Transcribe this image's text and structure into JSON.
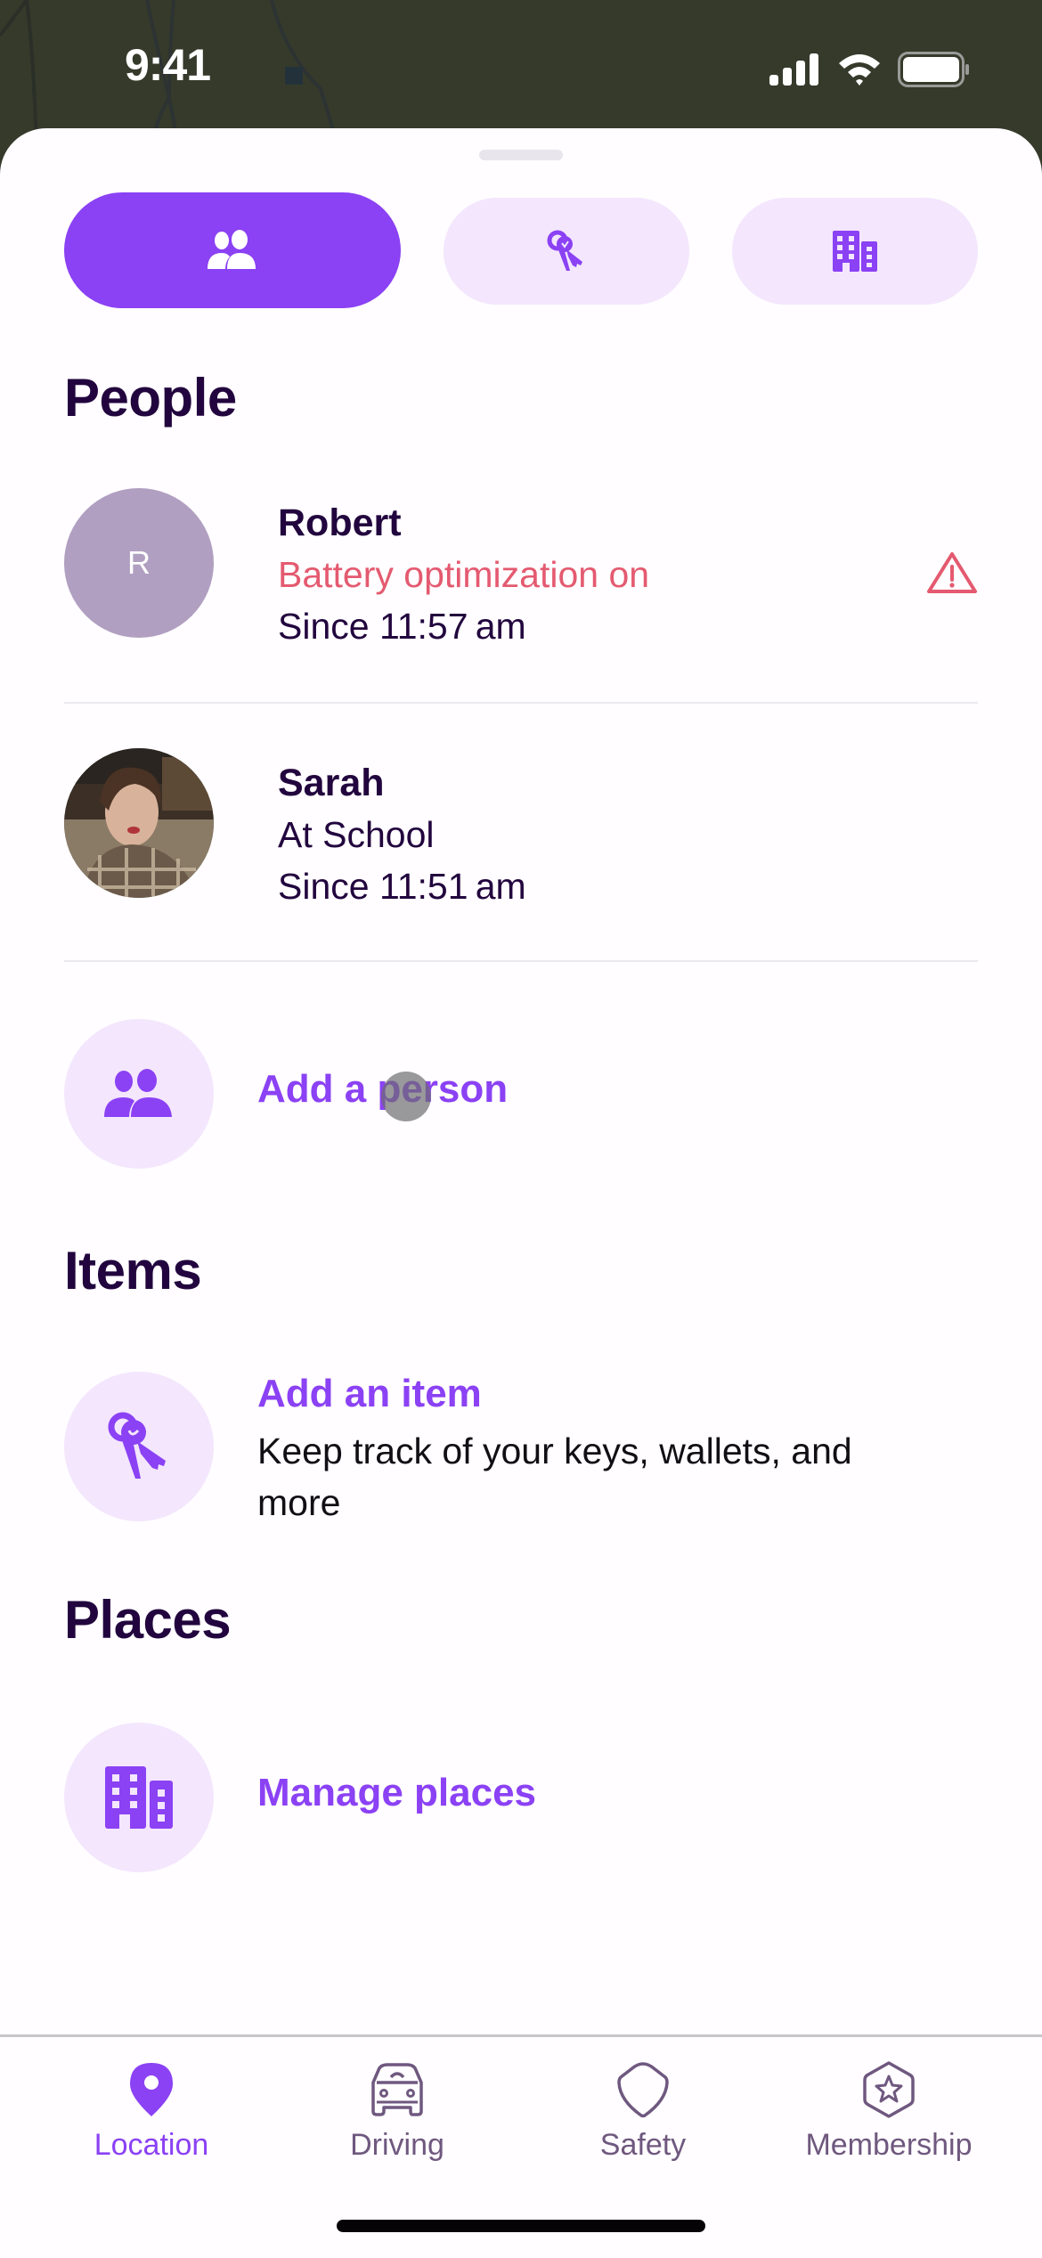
{
  "status_bar": {
    "time": "9:41"
  },
  "segmented_control": {
    "tabs": [
      {
        "icon": "people-icon",
        "selected": true
      },
      {
        "icon": "keys-icon",
        "selected": false
      },
      {
        "icon": "building-icon",
        "selected": false
      }
    ]
  },
  "people": {
    "title": "People",
    "members": [
      {
        "name": "Robert",
        "initial": "R",
        "status": "Battery optimization on",
        "since": "Since 11:57 am",
        "warning": true
      },
      {
        "name": "Sarah",
        "status": "At School",
        "since": "Since 11:51 am",
        "warning": false
      }
    ],
    "add_label": "Add a person"
  },
  "items": {
    "title": "Items",
    "add_label": "Add an item",
    "add_description": "Keep track of your keys, wallets, and more"
  },
  "places": {
    "title": "Places",
    "manage_label": "Manage places"
  },
  "tab_bar": {
    "tabs": [
      {
        "label": "Location",
        "icon": "location-pin-icon",
        "active": true
      },
      {
        "label": "Driving",
        "icon": "car-icon",
        "active": false
      },
      {
        "label": "Safety",
        "icon": "shield-icon",
        "active": false
      },
      {
        "label": "Membership",
        "icon": "star-badge-icon",
        "active": false
      }
    ]
  },
  "colors": {
    "accent": "#8b41f4",
    "accent_light": "#f3e6fd",
    "heading": "#22053e",
    "warning": "#e45a70",
    "tab_inactive": "#6f587f",
    "map_background": "#363a2b"
  }
}
